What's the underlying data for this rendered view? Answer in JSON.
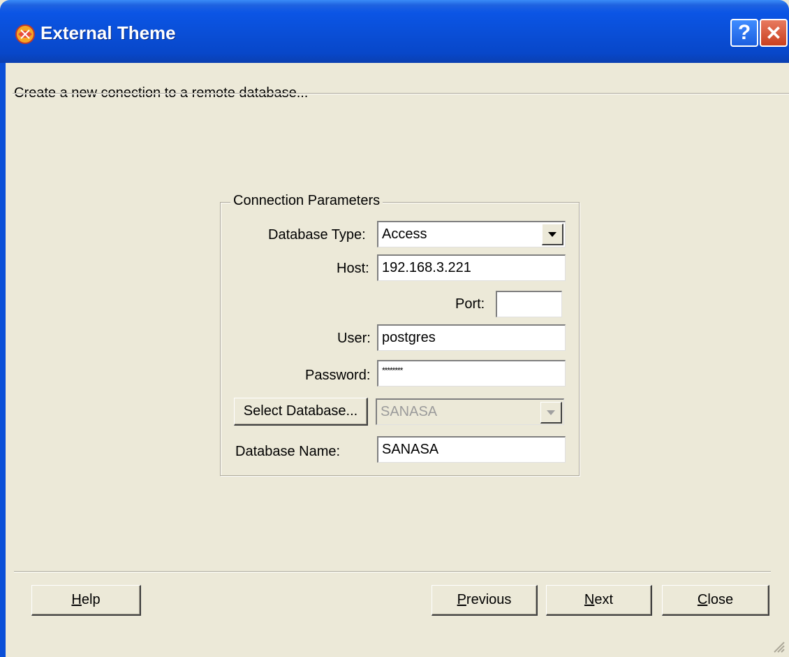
{
  "window": {
    "title": "External Theme",
    "help_glyph": "?",
    "close_glyph": "✕"
  },
  "instruction": "Create a new conection to a remote database...",
  "group": {
    "legend": "Connection Parameters",
    "database_type_label": "Database Type:",
    "database_type_value": "Access",
    "host_label": "Host:",
    "host_value": "192.168.3.221",
    "port_label": "Port:",
    "port_value": "",
    "user_label": "User:",
    "user_value": "postgres",
    "password_label": "Password:",
    "password_value": "********",
    "select_database_button": "Select Database...",
    "select_database_value": "SANASA",
    "database_name_label": "Database Name:",
    "database_name_value": "SANASA"
  },
  "buttons": {
    "help_first": "H",
    "help_rest": "elp",
    "previous_first": "P",
    "previous_rest": "revious",
    "next_first": "N",
    "next_rest": "ext",
    "close_first": "C",
    "close_rest": "lose"
  },
  "colors": {
    "titlebar": "#0a4fd8",
    "dialog_bg": "#ece9d8",
    "close_button": "#c9401f"
  }
}
